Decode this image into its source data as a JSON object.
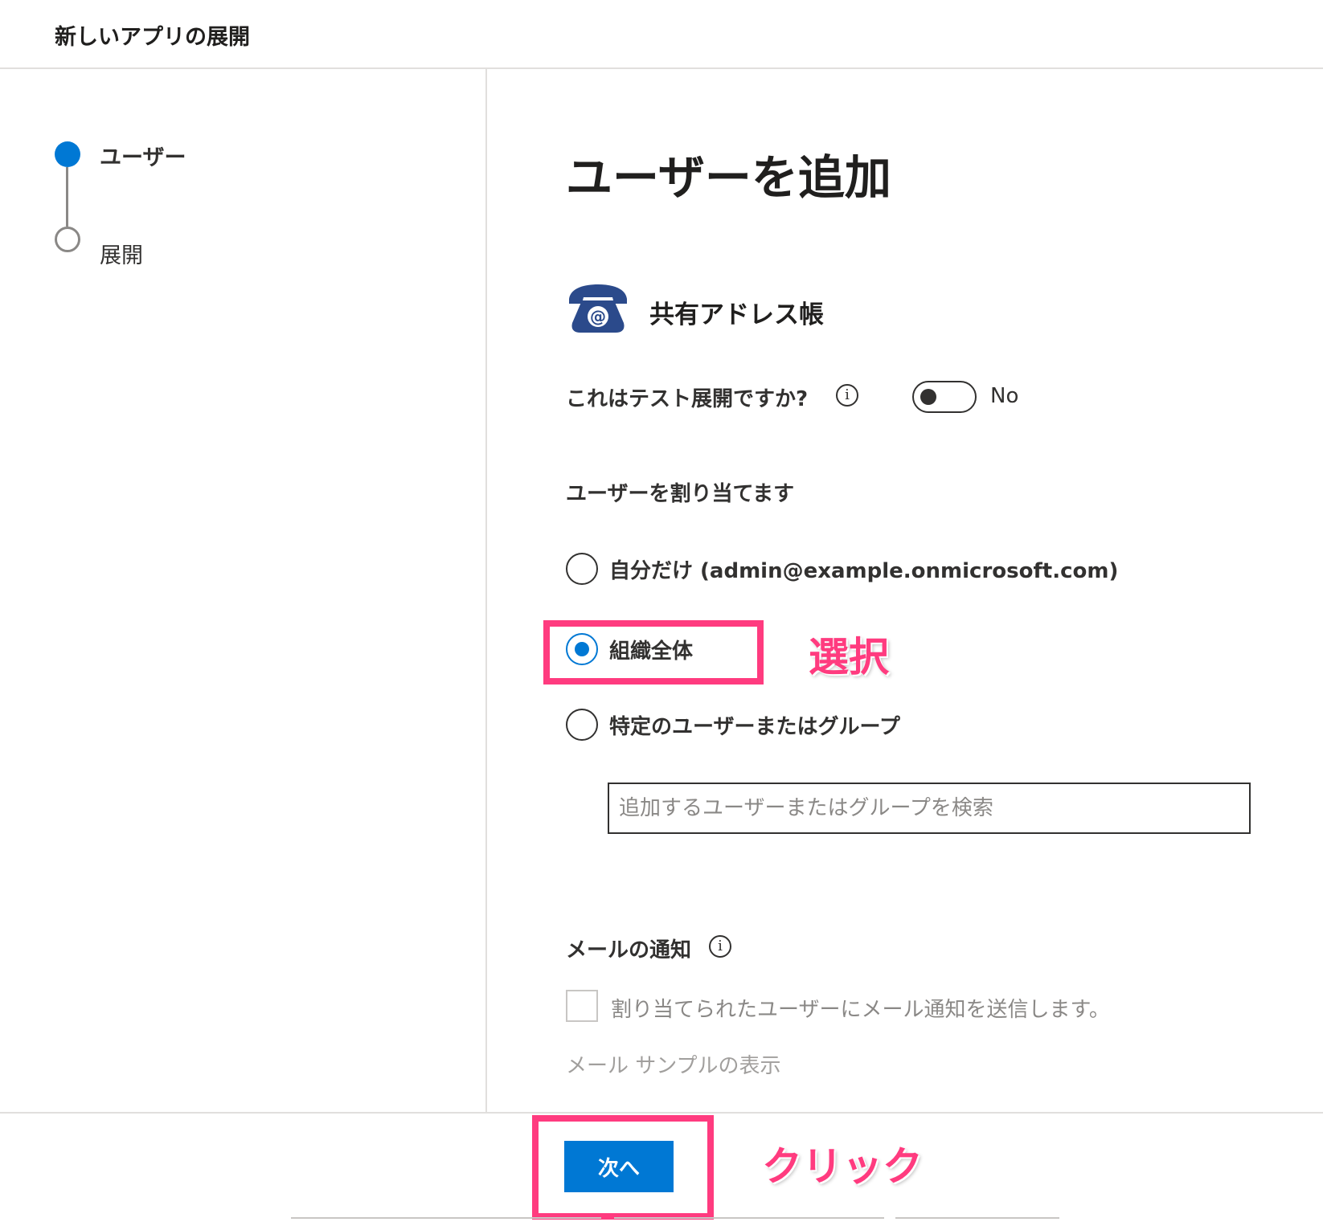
{
  "header": {
    "title": "新しいアプリの展開"
  },
  "steps": [
    {
      "label": "ユーザー",
      "state": "active"
    },
    {
      "label": "展開",
      "state": "inactive"
    }
  ],
  "main": {
    "title": "ユーザーを追加",
    "app": {
      "name": "共有アドレス帳",
      "icon": "telephone-at-icon",
      "icon_color": "#2b4a8b"
    },
    "test_deployment": {
      "label": "これはテスト展開ですか?",
      "value": "No",
      "enabled": false
    },
    "assign_users": {
      "label": "ユーザーを割り当てます",
      "options": [
        {
          "label": "自分だけ (admin@example.onmicrosoft.com)",
          "selected": false
        },
        {
          "label": "組織全体",
          "selected": true
        },
        {
          "label": "特定のユーザーまたはグループ",
          "selected": false
        }
      ],
      "search_placeholder": "追加するユーザーまたはグループを検索"
    },
    "email": {
      "label": "メールの通知",
      "checkbox_label": "割り当てられたユーザーにメール通知を送信します。",
      "checked": false,
      "sample_link": "メール サンプルの表示"
    }
  },
  "footer": {
    "next_label": "次へ"
  },
  "annotations": {
    "select_text": "選択",
    "click_text": "クリック",
    "color": "#ff3b7f"
  },
  "colors": {
    "accent": "#0078d4",
    "highlight": "#ff3b7f"
  }
}
